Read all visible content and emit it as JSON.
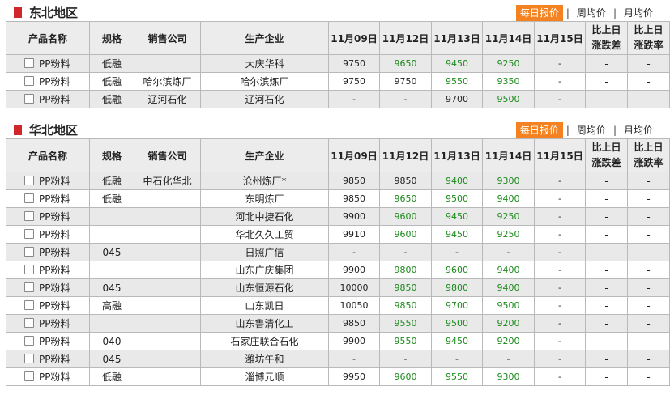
{
  "tabs": [
    "每日报价",
    "周均价",
    "月均价"
  ],
  "headers": {
    "product": "产品名称",
    "spec": "规格",
    "seller": "销售公司",
    "producer": "生产企业",
    "dates": [
      "11月09日",
      "11月12日",
      "11月13日",
      "11月14日",
      "11月15日"
    ],
    "diff": [
      "比上日",
      "涨跌差"
    ],
    "rate": [
      "比上日",
      "涨跌率"
    ]
  },
  "colors": {
    "accent": "#f58220",
    "up_down": "#1b8a1b",
    "section_mark": "#d0262c"
  },
  "sections": [
    {
      "title": "东北地区",
      "rows": [
        {
          "product": "PP粉料",
          "spec": "低融",
          "seller": "",
          "producer": "大庆华科",
          "v": [
            "9750",
            "9650",
            "9450",
            "9250",
            "-"
          ],
          "green": [
            false,
            true,
            true,
            true,
            false
          ],
          "diff": "-",
          "rate": "-"
        },
        {
          "product": "PP粉料",
          "spec": "低融",
          "seller": "哈尔滨炼厂",
          "producer": "哈尔滨炼厂",
          "v": [
            "9750",
            "9750",
            "9550",
            "9350",
            "-"
          ],
          "green": [
            false,
            false,
            true,
            true,
            false
          ],
          "diff": "-",
          "rate": "-"
        },
        {
          "product": "PP粉料",
          "spec": "低融",
          "seller": "辽河石化",
          "producer": "辽河石化",
          "v": [
            "-",
            "-",
            "9700",
            "9500",
            "-"
          ],
          "green": [
            false,
            false,
            false,
            true,
            false
          ],
          "diff": "-",
          "rate": "-"
        }
      ]
    },
    {
      "title": "华北地区",
      "rows": [
        {
          "product": "PP粉料",
          "spec": "低融",
          "seller": "中石化华北",
          "producer": "沧州炼厂*",
          "v": [
            "9850",
            "9850",
            "9400",
            "9300",
            "-"
          ],
          "green": [
            false,
            false,
            true,
            true,
            false
          ],
          "diff": "-",
          "rate": "-"
        },
        {
          "product": "PP粉料",
          "spec": "低融",
          "seller": "",
          "producer": "东明炼厂",
          "v": [
            "9850",
            "9650",
            "9500",
            "9400",
            "-"
          ],
          "green": [
            false,
            true,
            true,
            true,
            false
          ],
          "diff": "-",
          "rate": "-"
        },
        {
          "product": "PP粉料",
          "spec": "",
          "seller": "",
          "producer": "河北中捷石化",
          "v": [
            "9900",
            "9600",
            "9450",
            "9250",
            "-"
          ],
          "green": [
            false,
            true,
            true,
            true,
            false
          ],
          "diff": "-",
          "rate": "-"
        },
        {
          "product": "PP粉料",
          "spec": "",
          "seller": "",
          "producer": "华北久久工贸",
          "v": [
            "9910",
            "9600",
            "9450",
            "9250",
            "-"
          ],
          "green": [
            false,
            true,
            true,
            true,
            false
          ],
          "diff": "-",
          "rate": "-"
        },
        {
          "product": "PP粉料",
          "spec": "045",
          "seller": "",
          "producer": "日照广信",
          "v": [
            "-",
            "-",
            "-",
            "-",
            "-"
          ],
          "green": [
            false,
            false,
            false,
            false,
            false
          ],
          "diff": "-",
          "rate": "-"
        },
        {
          "product": "PP粉料",
          "spec": "",
          "seller": "",
          "producer": "山东广庆集团",
          "v": [
            "9900",
            "9800",
            "9600",
            "9400",
            "-"
          ],
          "green": [
            false,
            true,
            true,
            true,
            false
          ],
          "diff": "-",
          "rate": "-"
        },
        {
          "product": "PP粉料",
          "spec": "045",
          "seller": "",
          "producer": "山东恒源石化",
          "v": [
            "10000",
            "9850",
            "9800",
            "9400",
            "-"
          ],
          "green": [
            false,
            true,
            true,
            true,
            false
          ],
          "diff": "-",
          "rate": "-"
        },
        {
          "product": "PP粉料",
          "spec": "高融",
          "seller": "",
          "producer": "山东凯日",
          "v": [
            "10050",
            "9850",
            "9700",
            "9500",
            "-"
          ],
          "green": [
            false,
            true,
            true,
            true,
            false
          ],
          "diff": "-",
          "rate": "-"
        },
        {
          "product": "PP粉料",
          "spec": "",
          "seller": "",
          "producer": "山东鲁清化工",
          "v": [
            "9850",
            "9550",
            "9500",
            "9200",
            "-"
          ],
          "green": [
            false,
            true,
            true,
            true,
            false
          ],
          "diff": "-",
          "rate": "-"
        },
        {
          "product": "PP粉料",
          "spec": "040",
          "seller": "",
          "producer": "石家庄联合石化",
          "v": [
            "9900",
            "9550",
            "9450",
            "9200",
            "-"
          ],
          "green": [
            false,
            true,
            true,
            true,
            false
          ],
          "diff": "-",
          "rate": "-"
        },
        {
          "product": "PP粉料",
          "spec": "045",
          "seller": "",
          "producer": "潍坊午和",
          "v": [
            "-",
            "-",
            "-",
            "-",
            "-"
          ],
          "green": [
            false,
            false,
            false,
            false,
            false
          ],
          "diff": "-",
          "rate": "-"
        },
        {
          "product": "PP粉料",
          "spec": "低融",
          "seller": "",
          "producer": "淄博元顺",
          "v": [
            "9950",
            "9600",
            "9550",
            "9300",
            "-"
          ],
          "green": [
            false,
            true,
            true,
            true,
            false
          ],
          "diff": "-",
          "rate": "-"
        }
      ]
    }
  ]
}
